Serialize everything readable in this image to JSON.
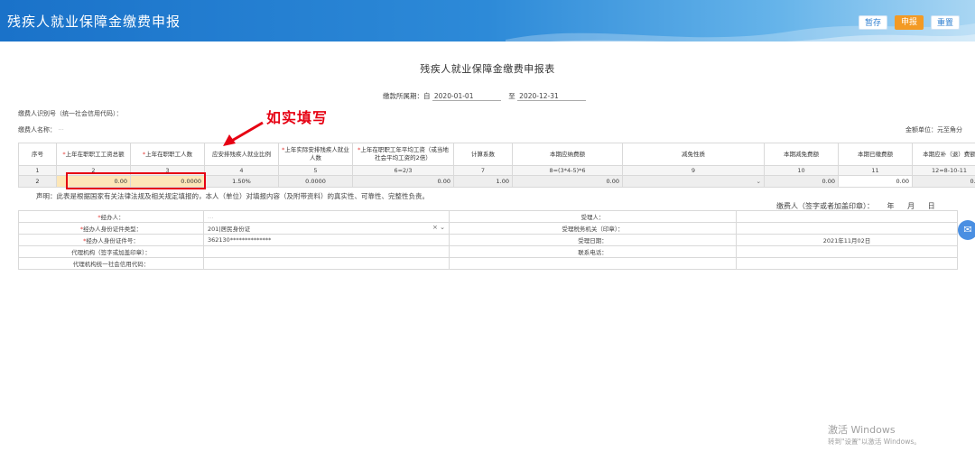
{
  "header": {
    "title": "残疾人就业保障金缴费申报",
    "buttons": {
      "save": "暂存",
      "submit": "申报",
      "reset": "重置"
    }
  },
  "form": {
    "title": "残疾人就业保障金缴费申报表",
    "period_label": "缴款所属期：自",
    "period_start": "2020-01-01",
    "period_to": "至",
    "period_end": "2020-12-31",
    "taxpayer_id_label": "缴费人识别号（统一社会信用代码）：",
    "taxpayer_name_label": "缴费人名称：",
    "taxpayer_name_value": "···",
    "unit_label": "金额单位：元至角分"
  },
  "table": {
    "headers": [
      {
        "label": "序号",
        "required": false
      },
      {
        "label": "上年在职职工工资总额",
        "required": true
      },
      {
        "label": "上年在职职工人数",
        "required": true
      },
      {
        "label": "应安排残疾人就业比例",
        "required": false
      },
      {
        "label": "上年实际安排残疾人就业人数",
        "required": true
      },
      {
        "label": "上年在职职工年平均工资（或当地社会平均工资的2倍）",
        "required": true
      },
      {
        "label": "计算系数",
        "required": false
      },
      {
        "label": "本期应纳费额",
        "required": false
      },
      {
        "label": "减免性质",
        "required": false
      },
      {
        "label": "本期减免费额",
        "required": false
      },
      {
        "label": "本期已缴费额",
        "required": false
      },
      {
        "label": "本期应补（退）费额",
        "required": false
      }
    ],
    "index_row": [
      "1",
      "2",
      "3",
      "4",
      "5",
      "6=2/3",
      "7",
      "8=(3*4-5)*6",
      "9",
      "10",
      "11",
      "12=8-10-11"
    ],
    "data_row": {
      "seq": "2",
      "wage_total": "0.00",
      "employee_count": "0.0000",
      "ratio": "1.50%",
      "disabled_count": "0.0000",
      "avg_wage": "0.00",
      "coefficient": "1.00",
      "payable": "0.00",
      "reduction_type": "",
      "reduction_amount": "0.00",
      "paid": "0.00",
      "refund": "0.00"
    }
  },
  "declaration": "声明：此表是根据国家有关法律法规及相关规定填报的，本人（单位）对填报内容（及附带资料）的真实性、可靠性、完整性负责。",
  "sign_line": "缴费人（签字或者加盖印章）： 年 月 日",
  "info": {
    "handler_label": "经办人：",
    "handler_value": "…",
    "receiver_label": "受理人：",
    "id_type_label": "经办人身份证件类型：",
    "id_type_value": "201|居民身份证",
    "tax_office_label": "受理税务机关（印章）：",
    "id_no_label": "经办人身份证件号：",
    "id_no_value": "362130**************",
    "date_label": "受理日期：",
    "date_value": "2021年11月02日",
    "agent_label": "代理机构（签字或加盖印章）：",
    "phone_label": "联系电话：",
    "agent_code_label": "代理机构统一社会信用代码："
  },
  "annotation": "如实填写",
  "watermark": {
    "line1": "激活 Windows",
    "line2": "转到\"设置\"以激活 Windows。"
  },
  "colors": {
    "header_blue": "#1a72c9",
    "submit_orange": "#f39a24",
    "highlight_yellow": "#fde7b8",
    "annotation_red": "#e60012"
  }
}
